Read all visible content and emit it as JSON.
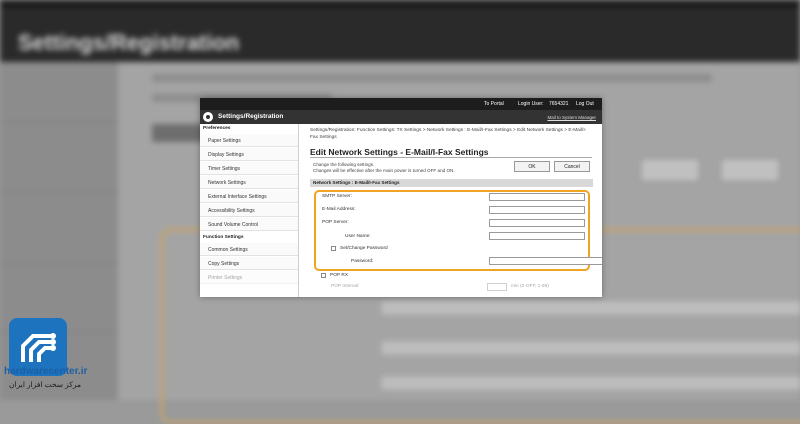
{
  "panel": {
    "top_links": [
      "To Portal",
      "Login User:",
      "7654321",
      "Log Out"
    ],
    "header_title": "Settings/Registration",
    "mail_link": "Mail to System Manager",
    "sidebar": {
      "group_preferences": "Preferences",
      "preferences_items": [
        "Paper Settings",
        "Display Settings",
        "Timer Settings",
        "Network Settings",
        "External Interface Settings",
        "Accessibility Settings",
        "Sound Volume Control"
      ],
      "group_function": "Function Settings",
      "function_items": [
        "Common Settings",
        "Copy Settings",
        "Printer Settings"
      ]
    },
    "breadcrumb": "Settings/Registration: Function Settings: TX Settings > Network Settings : E-Mail/I-Fax Settings > Edit Network Settings > E-Mail/I-Fax Settings",
    "title": "Edit Network Settings - E-Mail/I-Fax Settings",
    "note_line1": "Change the following settings.",
    "note_line2": "Changes will be effective after the main power is turned OFF and ON.",
    "ok_label": "OK",
    "cancel_label": "Cancel",
    "section_label": "Network Settings : E-Mail/I-Fax Settings",
    "fields": {
      "smtp": "SMTP Server:",
      "email": "E-Mail Address:",
      "pop": "POP Server:",
      "user": "User Name:",
      "set_password": "Set/Change Password",
      "password": "Password:",
      "pop_rx": "POP RX",
      "pop_interval": "POP Interval:",
      "pop_interval_hint": "min (0-OFF, 1-99)"
    }
  },
  "watermark": {
    "site": "hardwarecenter.ir",
    "persian": "مرکز سخت افزار ایران"
  },
  "colors": {
    "highlight": "#f0a424",
    "header": "#333333",
    "brand_blue": "#1e73be"
  }
}
